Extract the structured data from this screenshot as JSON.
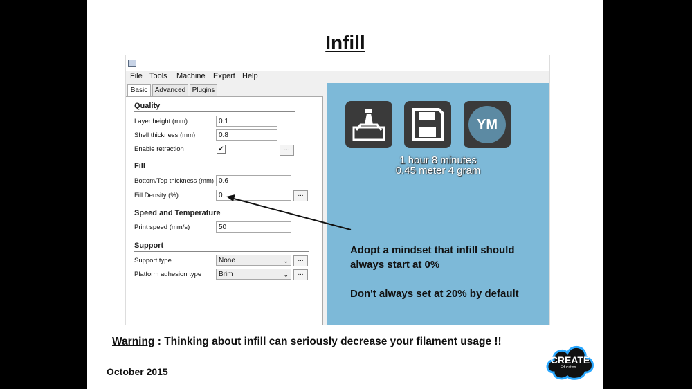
{
  "slide": {
    "title": "Infill",
    "warning_label": "Warning",
    "warning_text": " : Thinking about infill can seriously decrease your filament usage !!",
    "date": "October 2015",
    "logo_text": "CREATE",
    "logo_sub": "Education"
  },
  "menu": {
    "file": "File",
    "tools": "Tools",
    "machine": "Machine",
    "expert": "Expert",
    "help": "Help"
  },
  "tabs": {
    "basic": "Basic",
    "advanced": "Advanced",
    "plugins": "Plugins"
  },
  "quality": {
    "heading": "Quality",
    "layer_height_label": "Layer height (mm)",
    "layer_height_value": "0.1",
    "shell_thickness_label": "Shell thickness (mm)",
    "shell_thickness_value": "0.8",
    "retraction_label": "Enable retraction",
    "retraction_checked": "✔"
  },
  "fill": {
    "heading": "Fill",
    "bottom_top_label": "Bottom/Top thickness (mm)",
    "bottom_top_value": "0.6",
    "density_label": "Fill Density (%)",
    "density_value": "0"
  },
  "speed": {
    "heading": "Speed and Temperature",
    "print_speed_label": "Print speed (mm/s)",
    "print_speed_value": "50"
  },
  "support": {
    "heading": "Support",
    "support_type_label": "Support type",
    "support_type_value": "None",
    "adhesion_label": "Platform adhesion type",
    "adhesion_value": "Brim"
  },
  "dots_label": "...",
  "preview": {
    "ym_label": "YM",
    "time": "1 hour 8 minutes",
    "material": "0.45 meter 4 gram",
    "note1": "Adopt a mindset that infill should always start at 0%",
    "note2": "Don't always set at 20% by default"
  },
  "icons": [
    "load-model-icon",
    "save-floppy-icon",
    "ym-icon",
    "app-icon",
    "checkmark-icon",
    "chevron-down-icon"
  ],
  "colors": {
    "preview_bg": "#7db9d8",
    "button_bg": "#3a3a3a",
    "ym_circle": "#5c8aa3"
  }
}
